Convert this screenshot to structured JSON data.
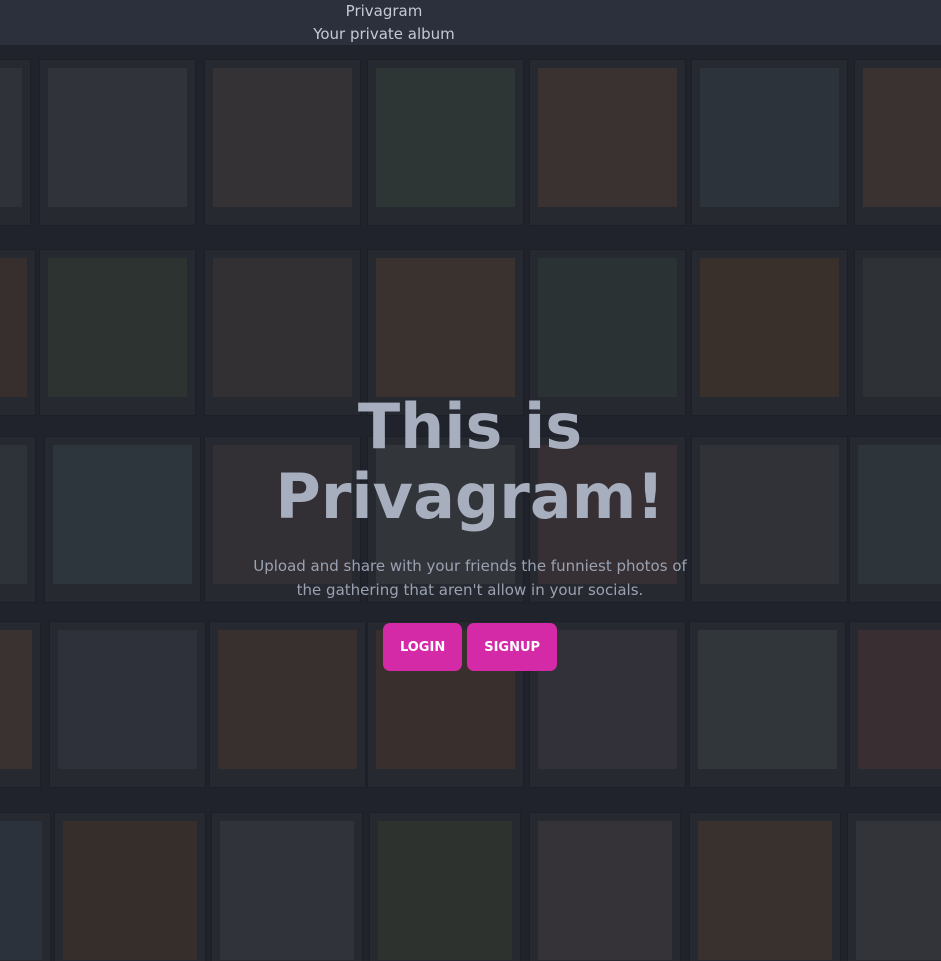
{
  "navbar": {
    "brand": "Privagram",
    "tagline": "Your private album"
  },
  "hero": {
    "title": "This is Privagram!",
    "text": "Upload and share with your friends the funniest photos of the gathering that aren't allow in your socials."
  },
  "buttons": {
    "login": "LOGIN",
    "signup": "SIGNUP"
  },
  "colors": {
    "accent": "#d42aa8",
    "navbar": "#2b303c",
    "title": "#a7aebe"
  }
}
